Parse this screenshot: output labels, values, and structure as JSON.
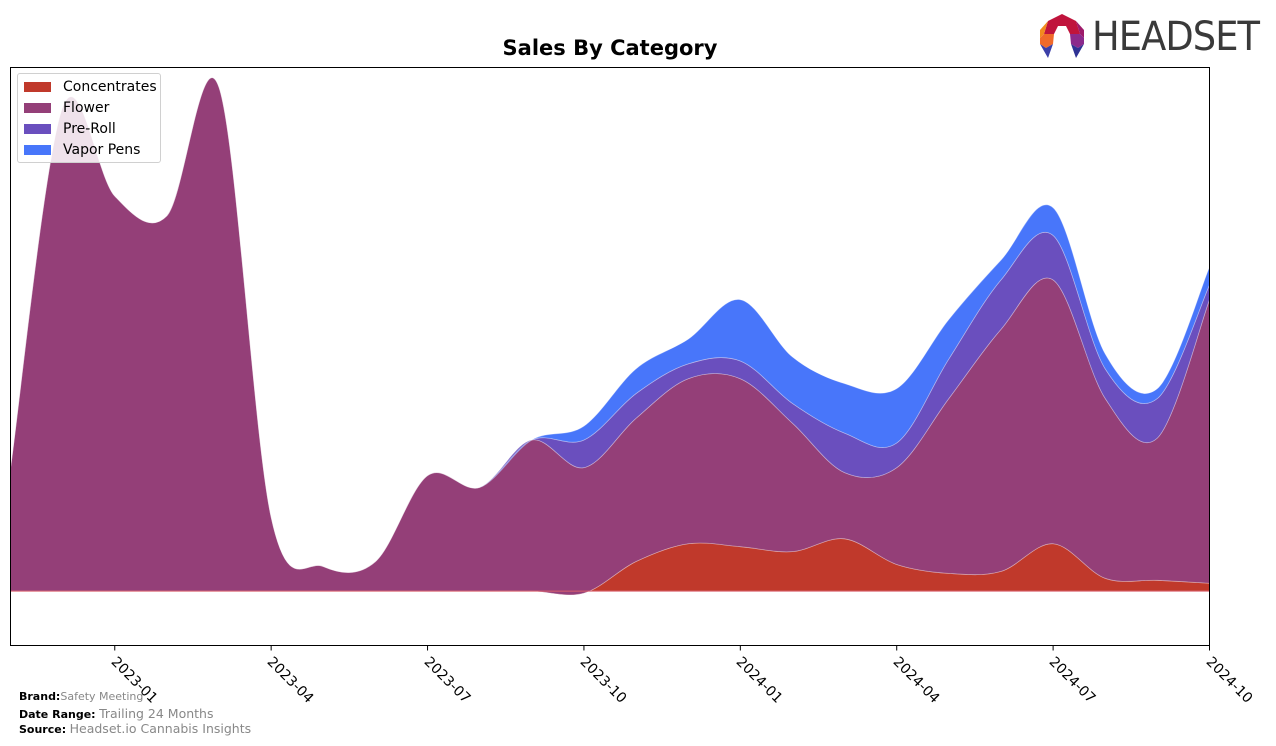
{
  "header": {
    "logo_text": "HEADSET"
  },
  "chart_data": {
    "type": "area",
    "stacked": true,
    "title": "Sales By Category",
    "xlabel": "",
    "ylabel": "",
    "x": [
      "2022-11",
      "2022-12",
      "2023-01",
      "2023-02",
      "2023-03",
      "2023-04",
      "2023-05",
      "2023-06",
      "2023-07",
      "2023-08",
      "2023-09",
      "2023-10",
      "2023-11",
      "2023-12",
      "2024-01",
      "2024-02",
      "2024-03",
      "2024-04",
      "2024-05",
      "2024-06",
      "2024-07",
      "2024-08",
      "2024-09",
      "2024-10"
    ],
    "xticks": [
      "2023-01",
      "2023-04",
      "2023-07",
      "2023-10",
      "2024-01",
      "2024-04",
      "2024-07",
      "2024-10"
    ],
    "ylim": [
      -55,
      530
    ],
    "yticks_visible": false,
    "grid": false,
    "legend_position": "top-left",
    "series": [
      {
        "name": "Concentrates",
        "color": "#c0392b",
        "values": [
          0,
          0,
          0,
          0,
          0,
          0,
          0,
          0,
          0,
          0,
          0,
          -2,
          30,
          48,
          45,
          40,
          53,
          27,
          18,
          20,
          48,
          13,
          11,
          8
        ]
      },
      {
        "name": "Flower",
        "color": "#943f78",
        "values": [
          125,
          490,
          400,
          380,
          510,
          75,
          25,
          30,
          117,
          105,
          153,
          127,
          145,
          167,
          170,
          130,
          67,
          98,
          177,
          245,
          267,
          182,
          144,
          287
        ]
      },
      {
        "name": "Pre-Roll",
        "color": "#6a4fbe",
        "values": [
          0,
          0,
          0,
          0,
          0,
          0,
          0,
          0,
          0,
          0,
          0,
          28,
          25,
          15,
          18,
          20,
          40,
          25,
          40,
          50,
          45,
          30,
          40,
          15
        ]
      },
      {
        "name": "Vapor Pens",
        "color": "#4876fa",
        "values": [
          0,
          0,
          0,
          0,
          0,
          0,
          0,
          0,
          0,
          0,
          0,
          14,
          25,
          25,
          62,
          47,
          50,
          55,
          40,
          20,
          28,
          15,
          10,
          18
        ]
      }
    ]
  },
  "footer": {
    "brand_label": "Brand:",
    "brand_value": "Safety Meeting",
    "date_range_label": "Date Range:",
    "date_range_value": "Trailing 24 Months",
    "source_label": "Source:",
    "source_value": "Headset.io Cannabis Insights"
  }
}
